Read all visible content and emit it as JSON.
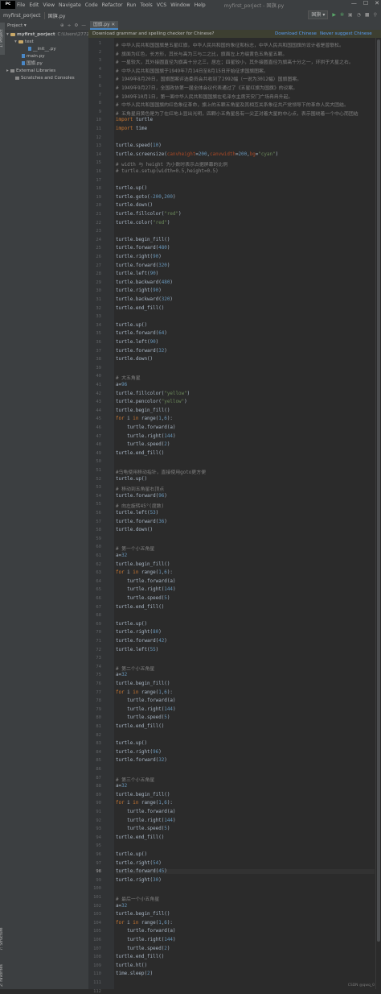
{
  "menubar": {
    "logo": "PC",
    "items": [
      "File",
      "Edit",
      "View",
      "Navigate",
      "Code",
      "Refactor",
      "Run",
      "Tools",
      "VCS",
      "Window",
      "Help"
    ],
    "window_title": "myfirst_porject - 国旗.py",
    "minimize": "—",
    "maximize": "☐",
    "close": "✕"
  },
  "breadcrumb": {
    "project": "myfirst_porject",
    "file": "国旗.py"
  },
  "run_toolbar": {
    "config": "国旗 ▾",
    "run": "▶",
    "debug": "✲",
    "coverage": "▣",
    "profile": "◔",
    "stop": "■",
    "search": "⚲"
  },
  "side_tabs": {
    "project": "1: Project",
    "structure": "7: Structure",
    "favorites": "2: Favorites"
  },
  "project_panel": {
    "title": "Project ▾",
    "controls": [
      "⊕",
      "÷",
      "⚙",
      "—"
    ],
    "tree": [
      {
        "indent": 2,
        "arrow": "▾",
        "icon": "folder",
        "label": "myfirst_porject",
        "path": "C:\\Users\\27725"
      },
      {
        "indent": 12,
        "arrow": "▾",
        "icon": "folder",
        "label": "test",
        "path": ""
      },
      {
        "indent": 24,
        "arrow": "",
        "icon": "py",
        "label": "__init__.py",
        "path": ""
      },
      {
        "indent": 16,
        "arrow": "",
        "icon": "py",
        "label": "main.py",
        "path": ""
      },
      {
        "indent": 16,
        "arrow": "",
        "icon": "py",
        "label": "国旗.py",
        "path": ""
      },
      {
        "indent": 2,
        "arrow": "▸",
        "icon": "lib",
        "label": "External Libraries",
        "path": ""
      },
      {
        "indent": 8,
        "arrow": "",
        "icon": "lib",
        "label": "Scratches and Consoles",
        "path": ""
      }
    ]
  },
  "tabs": [
    {
      "label": "国旗.py ✕"
    }
  ],
  "notification": {
    "message": "Download grammar and spelling checker for Chinese?",
    "action1": "Download Chinese",
    "action2": "Never suggest Chinese"
  },
  "editor": {
    "current_line": 98,
    "lines": [
      "# 中华人民共和国国旗是五星红旗，中华人民共和国的象征和标志，中华人民共和国国旗的设计者是曾联松。",
      "# 旗面为红色，长方形，其长与高为三与二之比，旗面左上方缀黄色五角星五颗。",
      "# 一星较大，其外接圆直径为旗高十分之三，居左；四星较小，其外接圆直径为旗高十分之一，环拱于大星之右。",
      "# 中华人民共和国国旗于1949年7月14日至8月15日开始征求国旗图案。",
      "# 1949年8月20日，国旗图案评选委员会共收到了2992幅（一说为3012幅）国旗图案。",
      "# 1949年9月27日，全国政协第一届全体会议代表通过了《五星红旗为国旗》的议案。",
      "# 1949年10月1日，第一面中华人民共和国国旗在毛泽东主席天安门广场冉冉升起。",
      "# 中华人民共和国国旗的红色象征革命，旗上的五颗五角星及其相互关系象征共产党领导下的革命人民大团结。",
      "# 五角星用黄色是为了在红地上显出光明，四颗小五角星各有一尖正对着大星的中心点，表示围绕着一个中心而团结",
      "import turtle",
      "import time",
      "",
      "turtle.speed(10)",
      "turtle.screensize(canvheight=200,canvwidth=200,bg=\"cyan\")",
      "# width 与 height 为小数时表示占据屏幕的比例",
      "# turtle.setup(width=0.5,height=0.5)",
      "",
      "turtle.up()",
      "turtle.goto(-200,200)",
      "turtle.down()",
      "turtle.fillcolor(\"red\")",
      "turtle.color(\"red\")",
      "",
      "turtle.begin_fill()",
      "turtle.forward(480)",
      "turtle.right(90)",
      "turtle.forward(320)",
      "turtle.left(90)",
      "turtle.backward(480)",
      "turtle.right(90)",
      "turtle.backward(320)",
      "turtle.end_fill()",
      "",
      "turtle.up()",
      "turtle.forward(64)",
      "turtle.left(90)",
      "turtle.forward(32)",
      "turtle.down()",
      "",
      "# 大五角星",
      "a=96",
      "turtle.fillcolor(\"yellow\")",
      "turtle.pencolor(\"yellow\")",
      "turtle.begin_fill()",
      "for i in range(1,6):",
      "    turtle.forward(a)",
      "    turtle.right(144)",
      "    turtle.speed(2)",
      "turtle.end_fill()",
      "",
      "#乌龟使用移动指针，直接使用goto更方便",
      "turtle.up()",
      "# 移动到五角星右顶点",
      "turtle.forward(96)",
      "# 向左旋转45°(度数)",
      "turtle.left(53)",
      "turtle.forward(36)",
      "turtle.down()",
      "",
      "# 第一个小五角星",
      "a=32",
      "turtle.begin_fill()",
      "for i in range(1,6):",
      "    turtle.forward(a)",
      "    turtle.right(144)",
      "    turtle.speed(5)",
      "turtle.end_fill()",
      "",
      "turtle.up()",
      "turtle.right(80)",
      "turtle.forward(42)",
      "turtle.left(55)",
      "",
      "# 第二个小五角星",
      "a=32",
      "turtle.begin_fill()",
      "for i in range(1,6):",
      "    turtle.forward(a)",
      "    turtle.right(144)",
      "    turtle.speed(5)",
      "turtle.end_fill()",
      "",
      "turtle.up()",
      "turtle.right(96)",
      "turtle.forward(32)",
      "",
      "# 第三个小五角星",
      "a=32",
      "turtle.begin_fill()",
      "for i in range(1,6):",
      "    turtle.forward(a)",
      "    turtle.right(144)",
      "    turtle.speed(5)",
      "turtle.end_fill()",
      "",
      "turtle.up()",
      "turtle.right(54)",
      "turtle.forward(45)",
      "turtle.right(30)",
      "",
      "# 最后一个小五角星",
      "a=32",
      "turtle.begin_fill()",
      "for i in range(1,6):",
      "    turtle.forward(a)",
      "    turtle.right(144)",
      "    turtle.speed(2)",
      "turtle.end_fill()",
      "turtle.ht()",
      "time.sleep(2)",
      "",
      ""
    ]
  },
  "watermark": "CSDN @qwq_0",
  "colors": {
    "keyword": "#cc7832",
    "string": "#6a8759",
    "number": "#6897bb",
    "comment": "#808080",
    "param": "#aa4926",
    "text": "#a9b7c6"
  }
}
